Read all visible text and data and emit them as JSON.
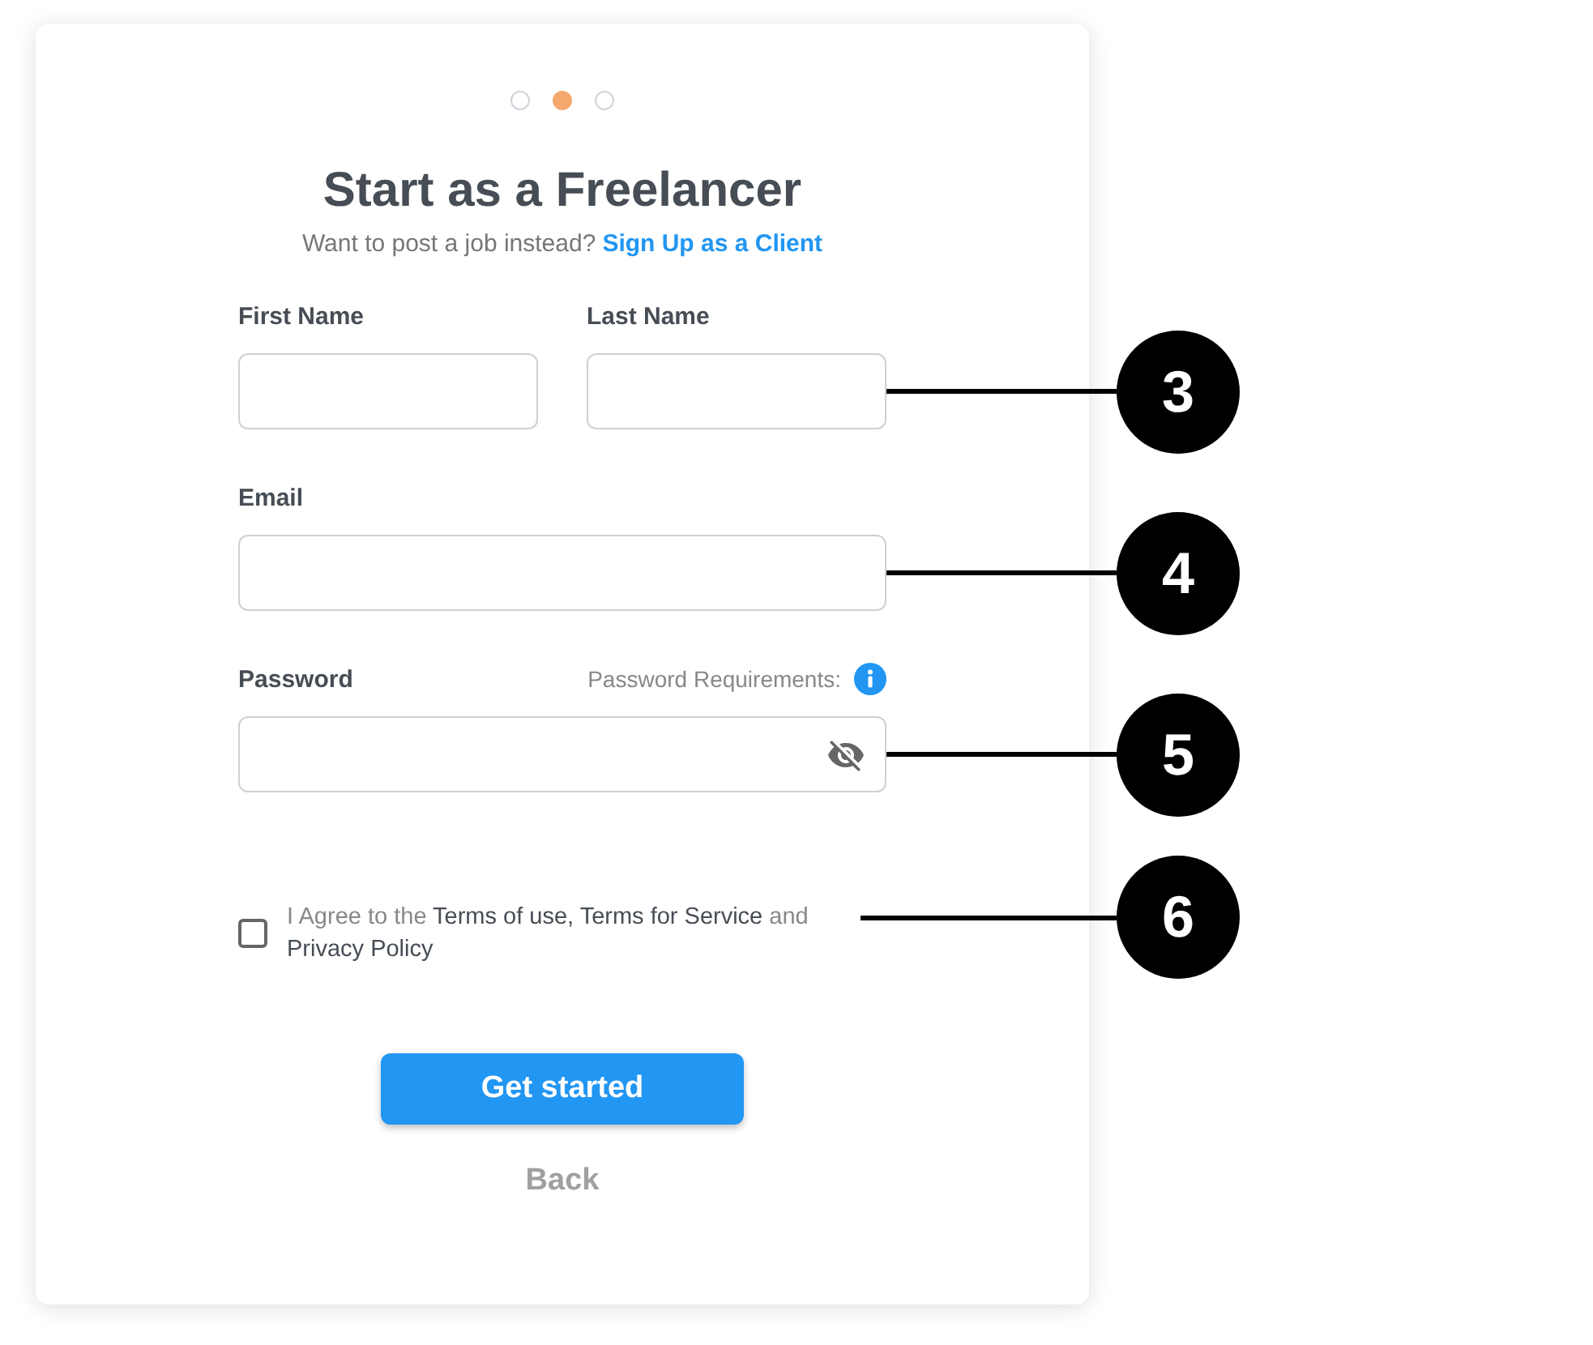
{
  "steps": [
    {
      "selected": false
    },
    {
      "selected": true
    },
    {
      "selected": false
    }
  ],
  "title": "Start as a Freelancer",
  "subtitle": {
    "text": "Want to post a job instead?",
    "link": "Sign Up as a Client"
  },
  "rows": [
    {
      "kind": "pair",
      "fields": [
        {
          "label": "First Name"
        },
        {
          "label": "Last Name"
        }
      ],
      "callout": "3"
    },
    {
      "kind": "single",
      "fields": [
        {
          "label": "Email"
        }
      ],
      "callout": "4"
    },
    {
      "kind": "password",
      "fields": [
        {
          "label": "Password",
          "hint": "Password Requirements:"
        }
      ],
      "callout": "5"
    }
  ],
  "agreement": {
    "checked": false,
    "text": "I Agree to the **Terms of use, Terms for Service** and **Privacy Policy**",
    "callout": "6"
  },
  "buttons": {
    "primary": "Get started",
    "secondary": "Back"
  }
}
